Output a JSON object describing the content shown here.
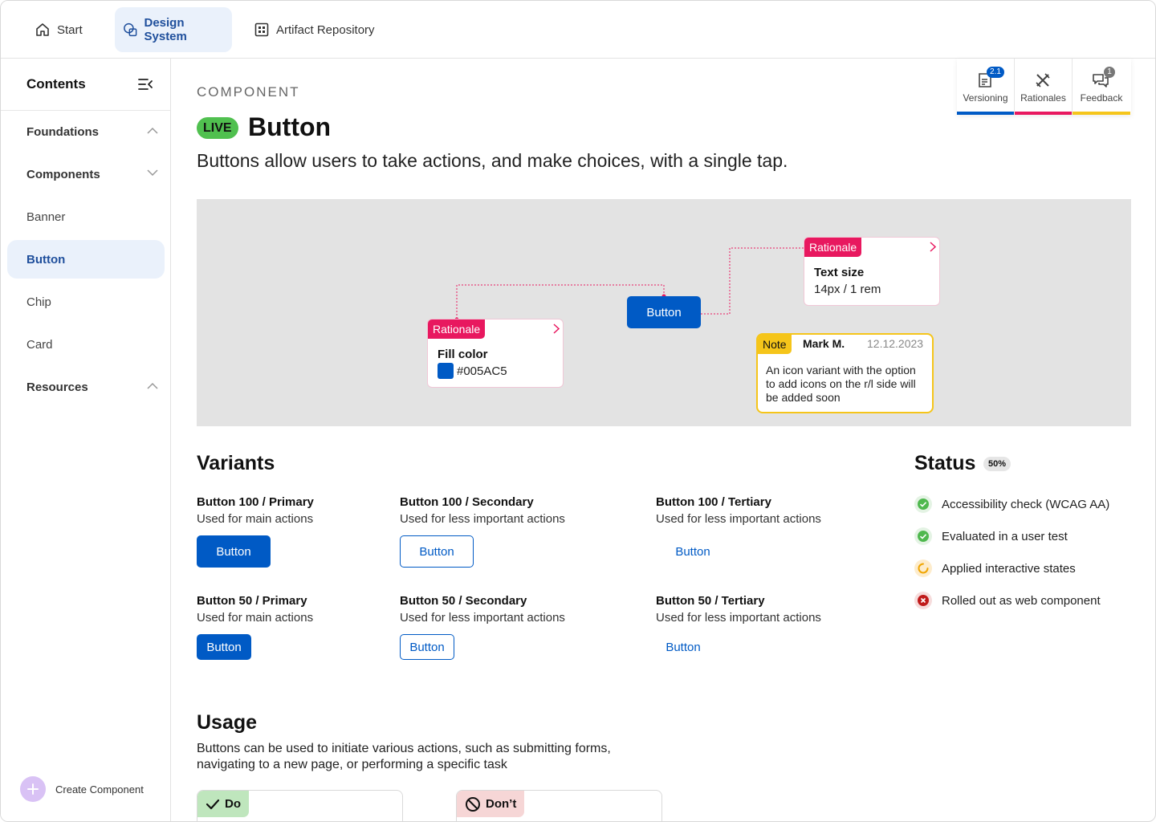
{
  "nav": {
    "items": [
      {
        "label": "Start",
        "icon": "home-icon"
      },
      {
        "label": "Design System",
        "icon": "design-system-icon",
        "active": true
      },
      {
        "label": "Artifact Repository",
        "icon": "grid-icon"
      }
    ]
  },
  "sidebar": {
    "title": "Contents",
    "items": [
      {
        "label": "Foundations",
        "group": true,
        "expanded": true
      },
      {
        "label": "Components",
        "group": true,
        "expanded": false
      },
      {
        "label": "Banner"
      },
      {
        "label": "Button",
        "active": true
      },
      {
        "label": "Chip"
      },
      {
        "label": "Card"
      },
      {
        "label": "Resources",
        "group": true,
        "expanded": true
      }
    ],
    "create_label": "Create Component"
  },
  "page": {
    "eyebrow": "COMPONENT",
    "status_tag": "LIVE",
    "title": "Button",
    "subtitle": "Buttons allow users to take actions, and make choices, with a single tap."
  },
  "tools": [
    {
      "label": "Versioning",
      "badge": "2.1",
      "color": "#005ac5"
    },
    {
      "label": "Rationales",
      "badge": "",
      "color": "#e8185f"
    },
    {
      "label": "Feedback",
      "badge": "1",
      "color": "#f5c51a"
    }
  ],
  "canvas": {
    "demo_button": "Button",
    "rationale_fill": {
      "tag": "Rationale",
      "title": "Fill color",
      "value": "#005AC5"
    },
    "rationale_text": {
      "tag": "Rationale",
      "title": "Text size",
      "value": "14px / 1 rem"
    },
    "note": {
      "tag": "Note",
      "author": "Mark M.",
      "date": "12.12.2023",
      "text": "An icon variant with the option to add icons on the r/l side will be added soon"
    }
  },
  "variants": {
    "heading": "Variants",
    "items": [
      {
        "title": "Button 100 / Primary",
        "desc": "Used for main actions",
        "button": "Button",
        "kind": "primary",
        "size": "100"
      },
      {
        "title": "Button 100 / Secondary",
        "desc": "Used for less important actions",
        "button": "Button",
        "kind": "secondary",
        "size": "100"
      },
      {
        "title": "Button 100 / Tertiary",
        "desc": "Used for less important actions",
        "button": "Button",
        "kind": "tertiary",
        "size": "100"
      },
      {
        "title": "Button 50 / Primary",
        "desc": "Used for main actions",
        "button": "Button",
        "kind": "primary",
        "size": "50"
      },
      {
        "title": "Button 50 / Secondary",
        "desc": "Used for less important actions",
        "button": "Button",
        "kind": "secondary",
        "size": "50"
      },
      {
        "title": "Button 50 / Tertiary",
        "desc": "Used for less important actions",
        "button": "Button",
        "kind": "tertiary",
        "size": "50"
      }
    ]
  },
  "status": {
    "heading": "Status",
    "percent": "50%",
    "items": [
      {
        "label": "Accessibility check (WCAG AA)",
        "state": "done"
      },
      {
        "label": "Evaluated in a user test",
        "state": "done"
      },
      {
        "label": "Applied interactive states",
        "state": "in-progress"
      },
      {
        "label": "Rolled out as web component",
        "state": "failed"
      }
    ]
  },
  "usage": {
    "heading": "Usage",
    "text": "Buttons can be used to initiate various actions, such as submitting forms, navigating to a new page, or performing a specific task",
    "do_label": "Do",
    "dont_label": "Don’t"
  },
  "colors": {
    "brand_blue": "#005ac5",
    "rationale_pink": "#e8185f",
    "note_yellow": "#f5c51a",
    "live_green": "#50c04f"
  }
}
